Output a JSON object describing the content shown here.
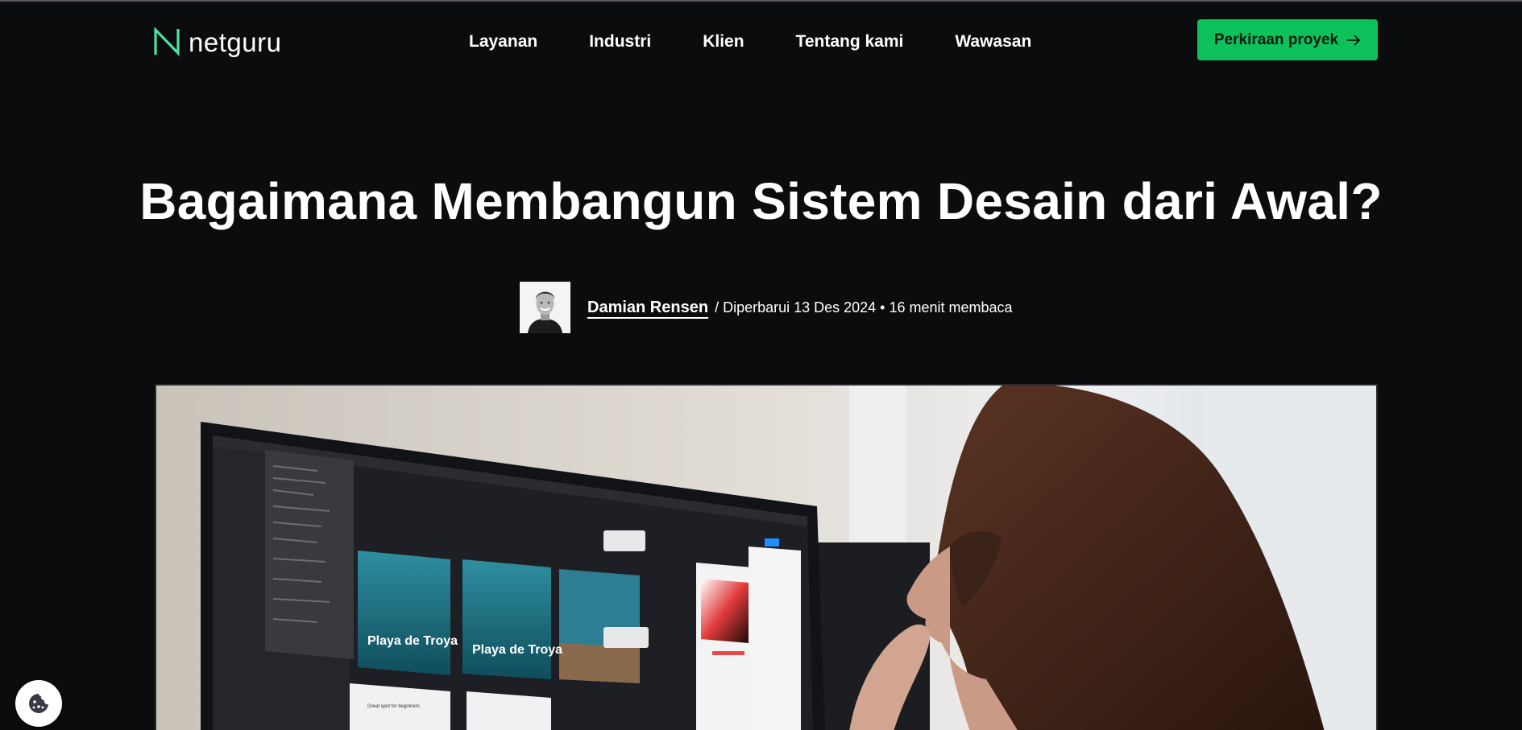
{
  "brand": {
    "name": "netguru",
    "accent": "#0ec25b",
    "logo_color": "#4fe0a0"
  },
  "nav": {
    "items": [
      {
        "label": "Layanan"
      },
      {
        "label": "Industri"
      },
      {
        "label": "Klien"
      },
      {
        "label": "Tentang kami"
      },
      {
        "label": "Wawasan"
      }
    ]
  },
  "cta": {
    "label": "Perkiraan proyek",
    "icon": "arrow-right-icon"
  },
  "article": {
    "title": "Bagaimana Membangun Sistem Desain dari Awal?",
    "author": "Damian Rensen",
    "meta": "/ Diperbarui 13 Des 2024 • 16 menit membaca"
  },
  "hero": {
    "app_card_1": "Playa de Troya",
    "app_card_2": "Playa de Troya",
    "app_card_3": "Playa de Troya",
    "panel_label": "Great spot for beginners"
  },
  "cookie": {
    "icon": "cookie-icon"
  }
}
